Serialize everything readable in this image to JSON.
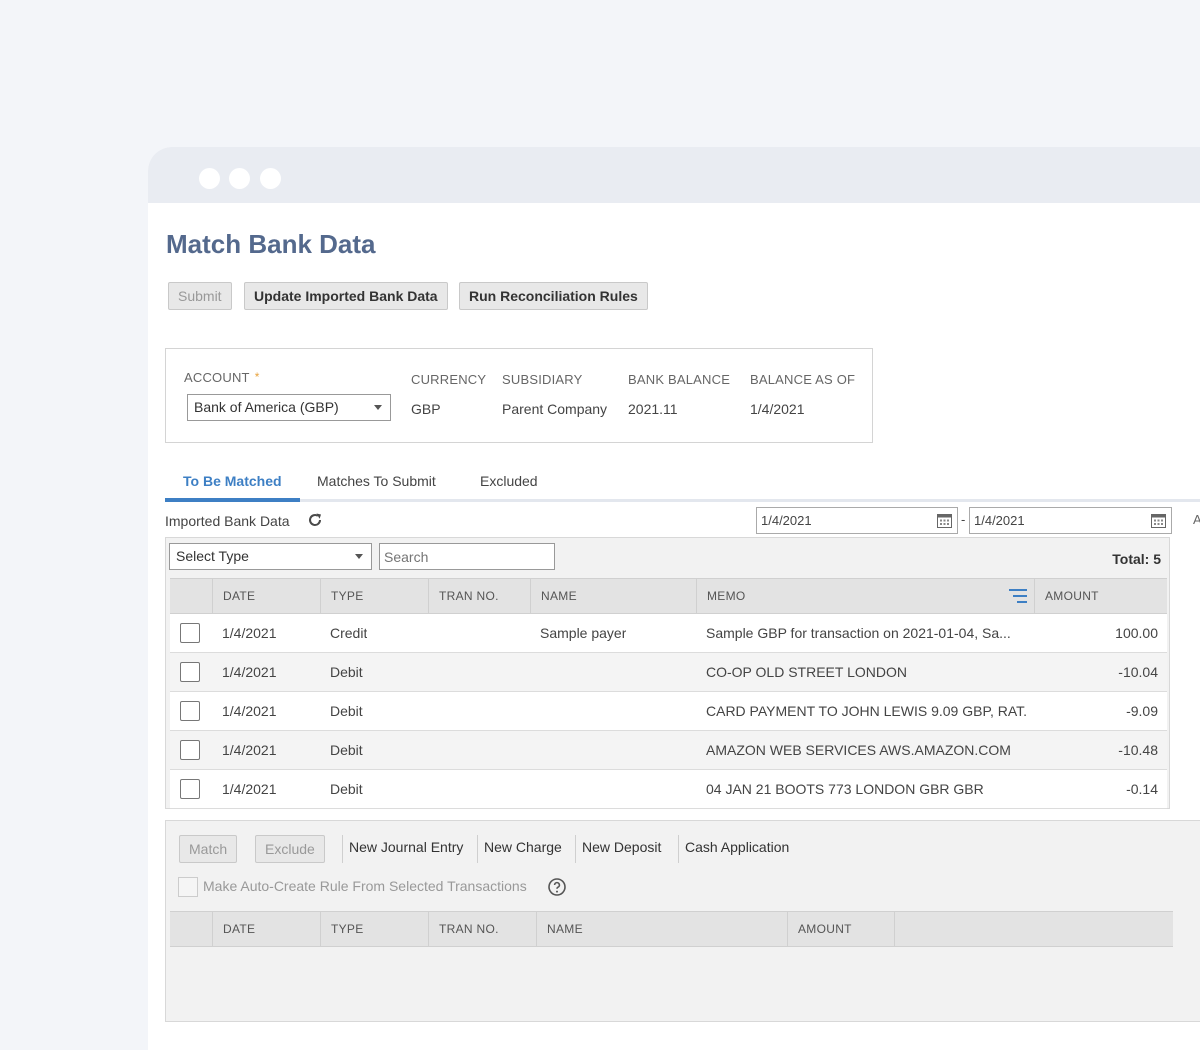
{
  "page": {
    "title": "Match Bank Data"
  },
  "toolbar": {
    "submit": "Submit",
    "update": "Update Imported Bank Data",
    "run_rules": "Run Reconciliation Rules"
  },
  "account": {
    "account_label": "ACCOUNT",
    "account_required": "*",
    "account_value": "Bank of America (GBP)",
    "currency_label": "CURRENCY",
    "currency_value": "GBP",
    "subsidiary_label": "SUBSIDIARY",
    "subsidiary_value": "Parent Company",
    "balance_label": "BANK BALANCE",
    "balance_value": "2021.11",
    "asof_label": "BALANCE AS OF",
    "asof_value": "1/4/2021"
  },
  "tabs": [
    {
      "label": "To Be Matched"
    },
    {
      "label": "Matches To Submit"
    },
    {
      "label": "Excluded"
    }
  ],
  "imported": {
    "label": "Imported Bank Data",
    "date_from": "1/4/2021",
    "date_to": "1/4/2021",
    "date_sep": "-",
    "type_select": "Select Type",
    "search_placeholder": "Search",
    "total": "Total: 5",
    "columns": [
      "DATE",
      "TYPE",
      "TRAN NO.",
      "NAME",
      "MEMO",
      "AMOUNT"
    ],
    "rows": [
      {
        "date": "1/4/2021",
        "type": "Credit",
        "tran": "",
        "name": "Sample payer",
        "memo": "Sample GBP for transaction on 2021-01-04, Sa...",
        "amount": "100.00"
      },
      {
        "date": "1/4/2021",
        "type": "Debit",
        "tran": "",
        "name": "",
        "memo": "CO-OP OLD STREET LONDON",
        "amount": "-10.04"
      },
      {
        "date": "1/4/2021",
        "type": "Debit",
        "tran": "",
        "name": "",
        "memo": "CARD PAYMENT TO JOHN LEWIS 9.09 GBP, RAT...",
        "amount": "-9.09"
      },
      {
        "date": "1/4/2021",
        "type": "Debit",
        "tran": "",
        "name": "",
        "memo": "AMAZON WEB SERVICES AWS.AMAZON.COM",
        "amount": "-10.48"
      },
      {
        "date": "1/4/2021",
        "type": "Debit",
        "tran": "",
        "name": "",
        "memo": "04 JAN 21 BOOTS 773 LONDON GBR GBR",
        "amount": "-0.14"
      }
    ]
  },
  "actions": {
    "match": "Match",
    "exclude": "Exclude",
    "new_journal": "New Journal Entry",
    "new_charge": "New Charge",
    "new_deposit": "New Deposit",
    "cash_application": "Cash Application",
    "auto_rule": "Make Auto-Create Rule From Selected Transactions"
  },
  "transactions": {
    "columns": [
      "DATE",
      "TYPE",
      "TRAN NO.",
      "NAME",
      "AMOUNT"
    ]
  },
  "colors": {
    "title": "#54698d",
    "accent": "#3d7fc4",
    "required": "#e8a33d"
  }
}
